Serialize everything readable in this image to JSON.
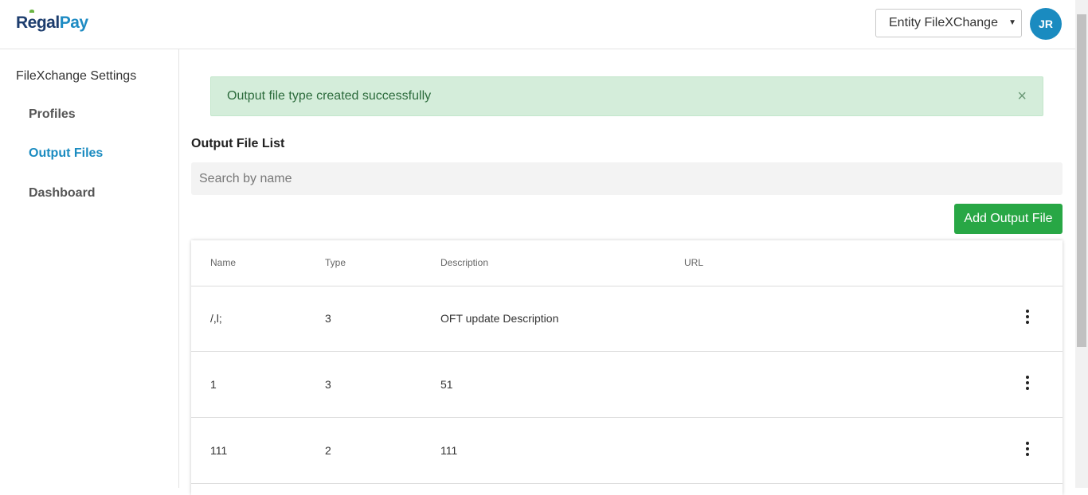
{
  "header": {
    "logo_part1": "Regal",
    "logo_part2": "Pay",
    "entity_select": "Entity FileXChange",
    "avatar_initials": "JR"
  },
  "sidebar": {
    "title": "FileXchange Settings",
    "items": [
      {
        "label": "Profiles",
        "active": false
      },
      {
        "label": "Output Files",
        "active": true
      },
      {
        "label": "Dashboard",
        "active": false
      }
    ]
  },
  "alert": {
    "message": "Output file type created successfully",
    "close": "×"
  },
  "main": {
    "title": "Output File List",
    "search_placeholder": "Search by name",
    "add_button": "Add Output File"
  },
  "table": {
    "columns": [
      "Name",
      "Type",
      "Description",
      "URL"
    ],
    "rows": [
      {
        "name": "/,l;",
        "type": "3",
        "description": "OFT update Description",
        "url": ""
      },
      {
        "name": "1",
        "type": "3",
        "description": "51",
        "url": ""
      },
      {
        "name": "111",
        "type": "2",
        "description": "111",
        "url": ""
      }
    ]
  },
  "colors": {
    "brand_blue": "#1a8bc0",
    "success_green": "#28a745",
    "alert_bg": "#d4edda"
  }
}
